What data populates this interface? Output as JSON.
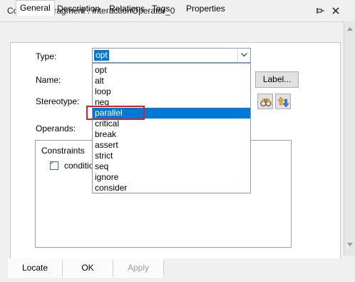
{
  "window": {
    "title": "Combined Fragment : interactionOperator_0",
    "pin_icon": "pin-icon",
    "close_icon": "close-icon"
  },
  "tabs": [
    {
      "label": "General",
      "active": true
    },
    {
      "label": "Description",
      "active": false
    },
    {
      "label": "Relations",
      "active": false
    },
    {
      "label": "Tags",
      "active": false
    },
    {
      "label": "Properties",
      "active": false
    }
  ],
  "form": {
    "type_label": "Type:",
    "type_value": "opt",
    "name_label": "Name:",
    "label_button": "Label...",
    "stereotype_label": "Stereotype:",
    "operands_label": "Operands:",
    "operands_tree": {
      "root": "Constraints",
      "child": "conditio"
    }
  },
  "dropdown": {
    "options": [
      "opt",
      "alt",
      "loop",
      "neg",
      "parallel",
      "critical",
      "break",
      "assert",
      "strict",
      "seq",
      "ignore",
      "consider"
    ],
    "selected": "parallel",
    "highlight_color": "#e02020"
  },
  "footer": {
    "locate": "Locate",
    "ok": "OK",
    "apply": "Apply"
  },
  "colors": {
    "selection": "#0078d7",
    "highlight_box": "#e02020"
  }
}
